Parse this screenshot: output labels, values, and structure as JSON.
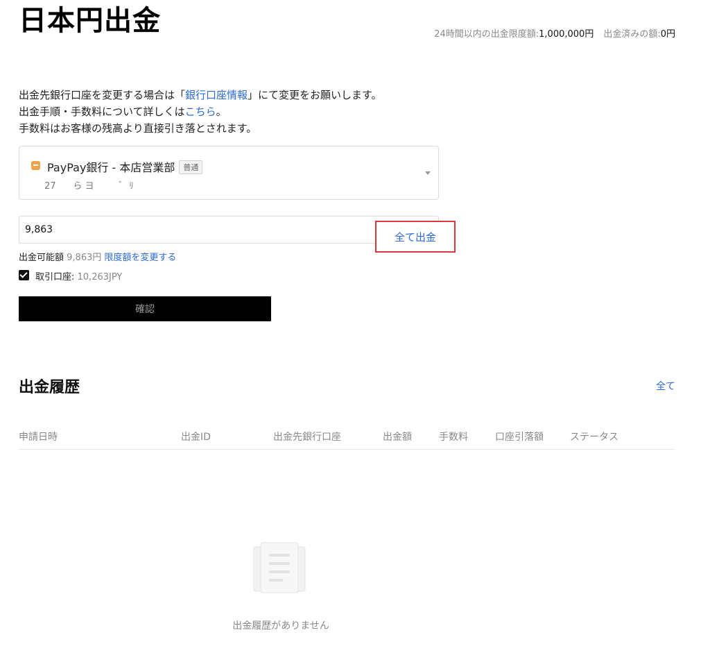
{
  "page": {
    "title": "日本円出金",
    "limit_label": "24時間以内の出金限度額:",
    "limit_value": "1,000,000円",
    "withdrawn_label": "出金済みの額:",
    "withdrawn_value": "0円"
  },
  "intro": {
    "line1_before": "出金先銀行口座を変更する場合は「",
    "line1_link": "銀行口座情報",
    "line1_after": "」にて変更をお願いします。",
    "line2_before": "出金手順・手数料について詳しくは",
    "line2_link": "こちら",
    "line2_after": "。",
    "line3": "手数料はお客様の残高より直接引き落とされます。"
  },
  "bank": {
    "icon": "bank-card-icon",
    "name": "PayPay銀行 - 本店営業部",
    "type_badge": "普通",
    "account_masked": "27      ら ヨ         ﾞ  ﾘ"
  },
  "amount": {
    "value": "9,863",
    "all_button": "全て出金",
    "available_label": "出金可能額",
    "available_value": "9,863円",
    "change_limit_link": "限度額を変更する"
  },
  "trading_account": {
    "checked": true,
    "label": "取引口座:",
    "value": "10,263JPY"
  },
  "confirm_button": "確認",
  "history": {
    "title": "出金履歴",
    "all_link": "全て",
    "columns": [
      "申請日時",
      "出金ID",
      "出金先銀行口座",
      "出金額",
      "手数料",
      "口座引落額",
      "ステータス"
    ],
    "rows": [],
    "empty_text": "出金履歴がありません",
    "empty_icon": "empty-document-icon"
  },
  "colors": {
    "link": "#2b6ad8",
    "highlight_border": "#d9363e",
    "bank_icon": "#f0a34a",
    "button_bg": "#000000"
  }
}
